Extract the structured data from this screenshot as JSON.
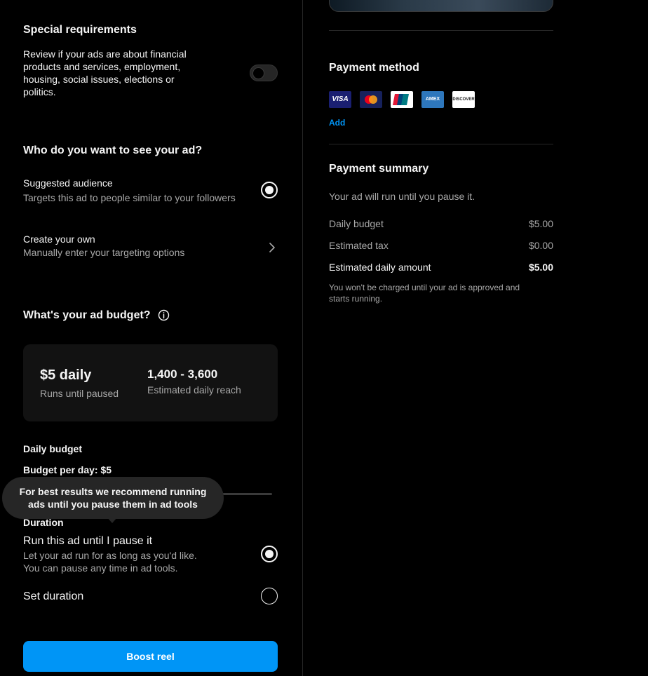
{
  "special": {
    "title": "Special requirements",
    "description_lines": [
      "Review if your ads are about financial",
      "products and services, employment,",
      "housing, social issues, elections or",
      "politics."
    ]
  },
  "audience": {
    "title": "Who do you want to see your ad?",
    "suggested_label": "Suggested audience",
    "suggested_desc": "Targets this ad to people similar to your followers",
    "create_label": "Create your own",
    "create_desc": "Manually enter your targeting options"
  },
  "budget": {
    "title": "What's your ad budget?",
    "daily_amount": "$5 daily",
    "runs_text": "Runs until paused",
    "reach_value": "1,400 - 3,600",
    "reach_label": "Estimated daily reach",
    "daily_budget_label": "Daily budget",
    "per_day_prefix": "Budget per day:",
    "per_day_value": "$5"
  },
  "tooltip": {
    "line1": "For best results we recommend running",
    "line2": "ads until you pause them in ad tools"
  },
  "duration": {
    "title": "Duration",
    "run_label": "Run this ad until I pause it",
    "run_desc_1": "Let your ad run for as long as you'd like.",
    "run_desc_2": "You can pause any time in ad tools.",
    "set_label": "Set duration"
  },
  "boost_button": "Boost reel",
  "payment_method": {
    "title": "Payment method",
    "cards": [
      {
        "name": "visa-card-icon",
        "label": "VISA"
      },
      {
        "name": "mastercard-card-icon",
        "label": ""
      },
      {
        "name": "unionpay-card-icon",
        "label": ""
      },
      {
        "name": "amex-card-icon",
        "label": "AMEX"
      },
      {
        "name": "discover-card-icon",
        "label": "DISCOVER"
      }
    ],
    "add_label": "Add"
  },
  "payment_summary": {
    "title": "Payment summary",
    "subtitle": "Your ad will run until you pause it.",
    "rows": [
      {
        "label": "Daily budget",
        "value": "$5.00"
      },
      {
        "label": "Estimated tax",
        "value": "$0.00"
      },
      {
        "label": "Estimated daily amount",
        "value": "$5.00"
      }
    ],
    "note_line1": "You won't be charged until your ad is approved and",
    "note_line2": "starts running."
  },
  "colors": {
    "accent": "#0095f6",
    "background": "#000000",
    "card": "#121212",
    "muted_text": "#a8a8a8"
  }
}
